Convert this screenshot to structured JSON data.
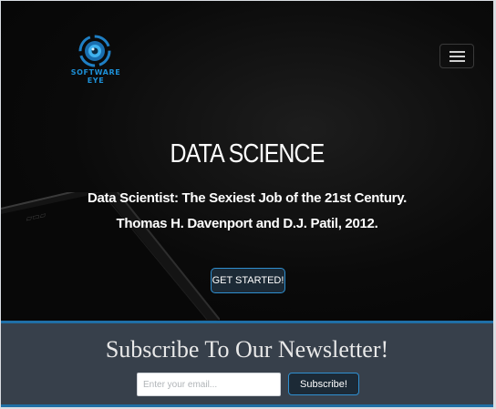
{
  "header": {
    "logo_text": "SOFTWARE EYE",
    "menu_icon": "hamburger-menu-icon"
  },
  "hero": {
    "title": "DATA SCIENCE",
    "quote_line1": "Data Scientist: The Sexiest Job of the 21st Century.",
    "quote_line2": "Thomas H. Davenport and D.J. Patil, 2012.",
    "cta_label": "GET STARTED!"
  },
  "newsletter": {
    "title": "Subscribe To Our Newsletter!",
    "email_placeholder": "Enter your email...",
    "email_value": "",
    "subscribe_label": "Subscribe!"
  },
  "colors": {
    "accent": "#2f8fd0",
    "logo_blue": "#1d8fd6",
    "newsletter_bg": "#37404b",
    "hero_bg": "#0b0b0b"
  }
}
